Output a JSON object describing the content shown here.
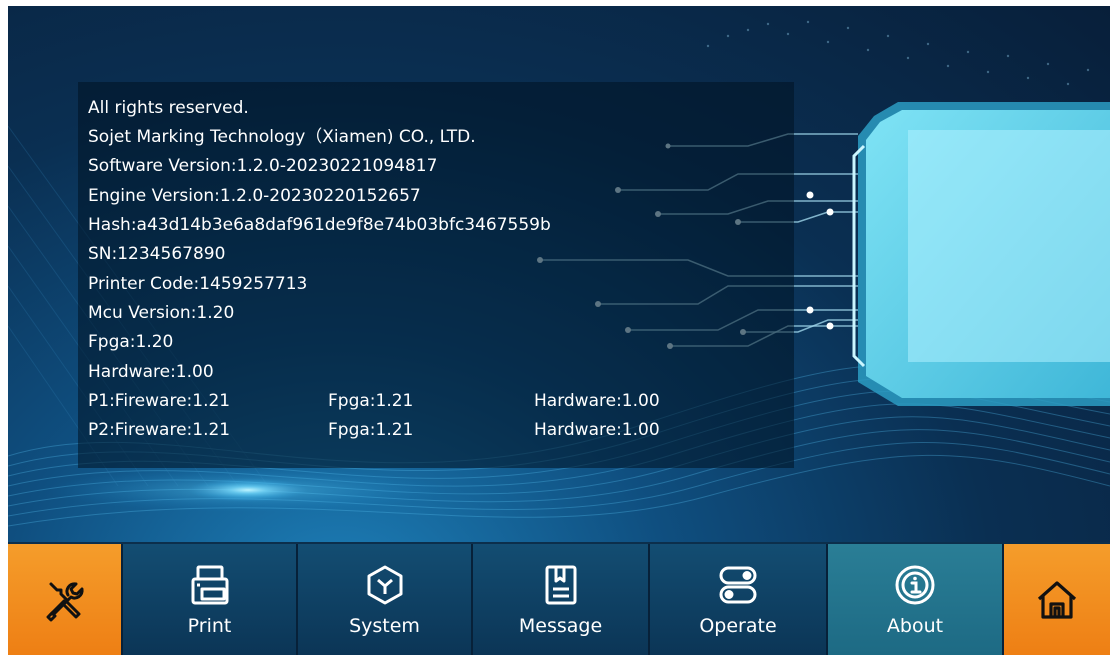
{
  "info": {
    "rights": "All rights reserved.",
    "company": "Sojet Marking Technology（Xiamen) CO., LTD.",
    "software_version": "Software Version:1.2.0-20230221094817",
    "engine_version": "Engine Version:1.2.0-20230220152657",
    "hash": "Hash:a43d14b3e6a8daf961de9f8e74b03bfc3467559b",
    "sn": "SN:1234567890",
    "printer_code": "Printer Code:1459257713",
    "mcu_version": "Mcu Version:1.20",
    "fpga": "Fpga:1.20",
    "hardware": "Hardware:1.00",
    "p1": {
      "fireware": "P1:Fireware:1.21",
      "fpga": "Fpga:1.21",
      "hardware": "Hardware:1.00"
    },
    "p2": {
      "fireware": "P2:Fireware:1.21",
      "fpga": "Fpga:1.21",
      "hardware": "Hardware:1.00"
    }
  },
  "nav": {
    "tools_icon": "tools-icon",
    "print": {
      "label": "Print",
      "icon": "printer-icon"
    },
    "system": {
      "label": "System",
      "icon": "cube-icon"
    },
    "message": {
      "label": "Message",
      "icon": "document-icon"
    },
    "operate": {
      "label": "Operate",
      "icon": "toggle-icon"
    },
    "about": {
      "label": "About",
      "icon": "info-icon",
      "active": true
    },
    "home_icon": "home-icon"
  },
  "colors": {
    "accent_orange": "#f08a1c",
    "active_teal": "#23728c",
    "nav_dark": "#0f4166"
  }
}
